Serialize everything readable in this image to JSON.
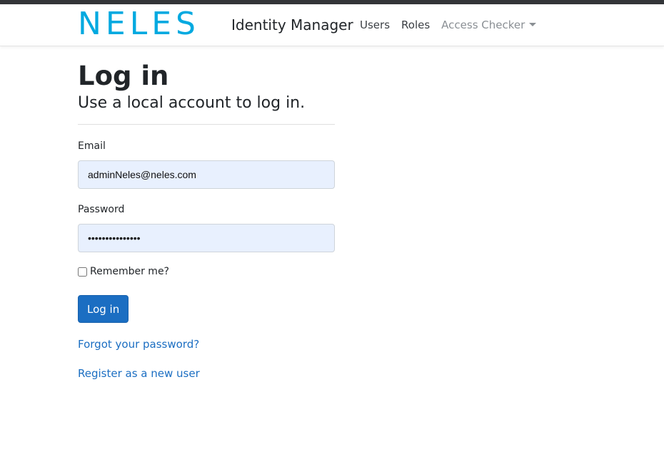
{
  "header": {
    "logo_text": "NELES",
    "brand_name": "Identity Manager",
    "nav": {
      "users": "Users",
      "roles": "Roles",
      "access_checker": "Access Checker"
    }
  },
  "login": {
    "title": "Log in",
    "subtitle": "Use a local account to log in.",
    "email_label": "Email",
    "email_value": "adminNeles@neles.com",
    "password_label": "Password",
    "password_value": "•••••••••••••••",
    "remember_label": "Remember me?",
    "remember_checked": false,
    "submit_label": "Log in",
    "forgot_link": "Forgot your password?",
    "register_link": "Register as a new user"
  },
  "colors": {
    "logo": "#00a9e0",
    "primary_button": "#1b6ec2",
    "autofill_bg": "#e8f0fe",
    "topbar": "#333538"
  }
}
